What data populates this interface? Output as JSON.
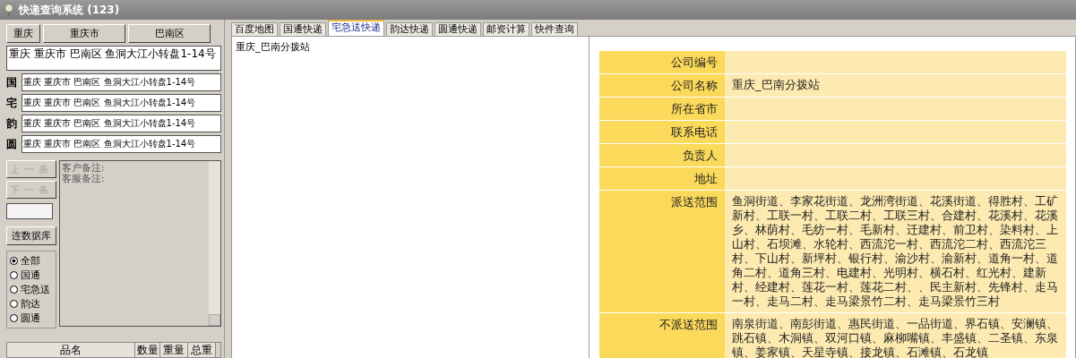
{
  "window": {
    "title": "快递查询系统 (123)"
  },
  "region_buttons": [
    "重庆",
    "重庆市",
    "巴南区"
  ],
  "address_box": {
    "value": "重庆 重庆市 巴南区 鱼洞大江小转盘1-14号"
  },
  "carrier_rows": [
    {
      "label": "国",
      "value": "重庆 重庆市 巴南区 鱼洞大江小转盘1-14号"
    },
    {
      "label": "宅",
      "value": "重庆 重庆市 巴南区 鱼洞大江小转盘1-14号"
    },
    {
      "label": "韵",
      "value": "重庆 重庆市 巴南区 鱼洞大江小转盘1-14号"
    },
    {
      "label": "圆",
      "value": "重庆 重庆市 巴南区 鱼洞大江小转盘1-14号"
    }
  ],
  "nav_buttons": [
    {
      "label": "上一条",
      "disabled": true
    },
    {
      "label": "下一条",
      "disabled": true
    }
  ],
  "db_button": "连数据库",
  "filters": [
    {
      "label": "全部",
      "selected": true
    },
    {
      "label": "国通",
      "selected": false
    },
    {
      "label": "宅急送",
      "selected": false
    },
    {
      "label": "韵达",
      "selected": false
    },
    {
      "label": "圆通",
      "selected": false
    }
  ],
  "notes": [
    "客户备注:",
    "客服备注:"
  ],
  "goods_table": {
    "columns": [
      "品名",
      "数量",
      "重量",
      "总重"
    ]
  },
  "tabs": [
    {
      "label": "百度地图",
      "selected": false
    },
    {
      "label": "国通快递",
      "selected": false
    },
    {
      "label": "宅急送快递",
      "selected": true
    },
    {
      "label": "韵达快递",
      "selected": false
    },
    {
      "label": "圆通快递",
      "selected": false
    },
    {
      "label": "邮资计算",
      "selected": false
    },
    {
      "label": "快件查询",
      "selected": false
    }
  ],
  "result_list": [
    "重庆_巴南分拨站"
  ],
  "info_table": {
    "rows": [
      {
        "label": "公司编号"
      },
      {
        "label": "公司名称",
        "value": "重庆_巴南分拨站"
      },
      {
        "label": "所在省市"
      },
      {
        "label": "联系电话"
      },
      {
        "label": "负责人"
      },
      {
        "label": "地址"
      },
      {
        "label": "派送范围",
        "value": "鱼洞街道、李家花街道、龙洲湾街道、花溪街道、得胜村、工矿新村、工联一村、工联二村、工联三村、合建村、花溪村、花溪乡、林荫村、毛纺一村、毛新村、迁建村、前卫村、染料村、上山村、石坝滩、水轮村、西流沱一村、西流沱二村、西流沱三村、下山村、新坪村、银行村、渝沙村、渝新村、道角一村、道角二村、道角三村、电建村、光明村、横石村、红光村、建新村、经建村、莲花一村、莲花二村、、民主新村、先锋村、走马一村、走马二村、走马梁景竹二村、走马梁景竹三村"
      },
      {
        "label": "不派送范围",
        "value": "南泉街道、南彭街道、惠民街道、一品街道、界石镇、安澜镇、跳石镇、木洞镇、双河口镇、麻柳嘴镇、丰盛镇、二圣镇、东泉镇、姜家镇、天星寺镇、接龙镇、石滩镇、石龙镇"
      }
    ]
  }
}
